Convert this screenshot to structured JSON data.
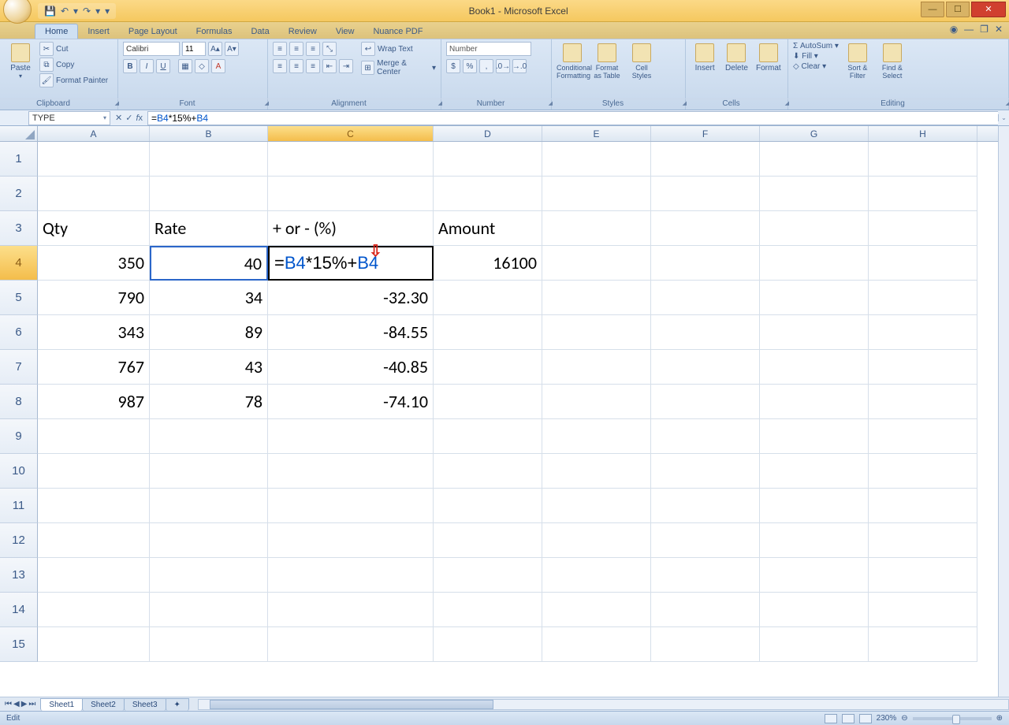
{
  "title": "Book1 - Microsoft Excel",
  "qat": {
    "save": "💾",
    "undo": "↶",
    "redo": "↷"
  },
  "tabs": [
    "Home",
    "Insert",
    "Page Layout",
    "Formulas",
    "Data",
    "Review",
    "View",
    "Nuance PDF"
  ],
  "active_tab": "Home",
  "ribbon": {
    "clipboard": {
      "label": "Clipboard",
      "paste": "Paste",
      "cut": "Cut",
      "copy": "Copy",
      "painter": "Format Painter"
    },
    "font": {
      "label": "Font",
      "name": "Calibri",
      "size": "11",
      "bold": "B",
      "italic": "I",
      "underline": "U"
    },
    "alignment": {
      "label": "Alignment",
      "wrap": "Wrap Text",
      "merge": "Merge & Center"
    },
    "number": {
      "label": "Number",
      "format": "Number",
      "currency": "$",
      "percent": "%",
      "comma": ","
    },
    "styles": {
      "label": "Styles",
      "cond": "Conditional Formatting",
      "fmt": "Format as Table",
      "cell": "Cell Styles"
    },
    "cells": {
      "label": "Cells",
      "insert": "Insert",
      "delete": "Delete",
      "format": "Format"
    },
    "editing": {
      "label": "Editing",
      "autosum": "AutoSum",
      "fill": "Fill",
      "clear": "Clear",
      "sort": "Sort & Filter",
      "find": "Find & Select"
    }
  },
  "namebox": "TYPE",
  "formula": {
    "prefix": "=",
    "ref1": "B4",
    "mid": "*15%+",
    "ref2": "B4"
  },
  "columns": [
    "A",
    "B",
    "C",
    "D",
    "E",
    "F",
    "G",
    "H"
  ],
  "rows": [
    "1",
    "2",
    "3",
    "4",
    "5",
    "6",
    "7",
    "8",
    "9",
    "10",
    "11",
    "12",
    "13",
    "14",
    "15"
  ],
  "cells": {
    "A3": "Qty",
    "B3": "Rate",
    "C3": "+ or - (%)",
    "D3": "Amount",
    "A4": "350",
    "B4": "40",
    "D4": "16100",
    "A5": "790",
    "B5": "34",
    "C5": "-32.30",
    "A6": "343",
    "B6": "89",
    "C6": "-84.55",
    "A7": "767",
    "B7": "43",
    "C7": "-40.85",
    "A8": "987",
    "B8": "78",
    "C8": "-74.10"
  },
  "editing_cell_html": {
    "eq": "=",
    "r1": "B4",
    "mid": "*15%+",
    "r2": "B4"
  },
  "sheets": [
    "Sheet1",
    "Sheet2",
    "Sheet3"
  ],
  "status_mode": "Edit",
  "zoom": "230%"
}
